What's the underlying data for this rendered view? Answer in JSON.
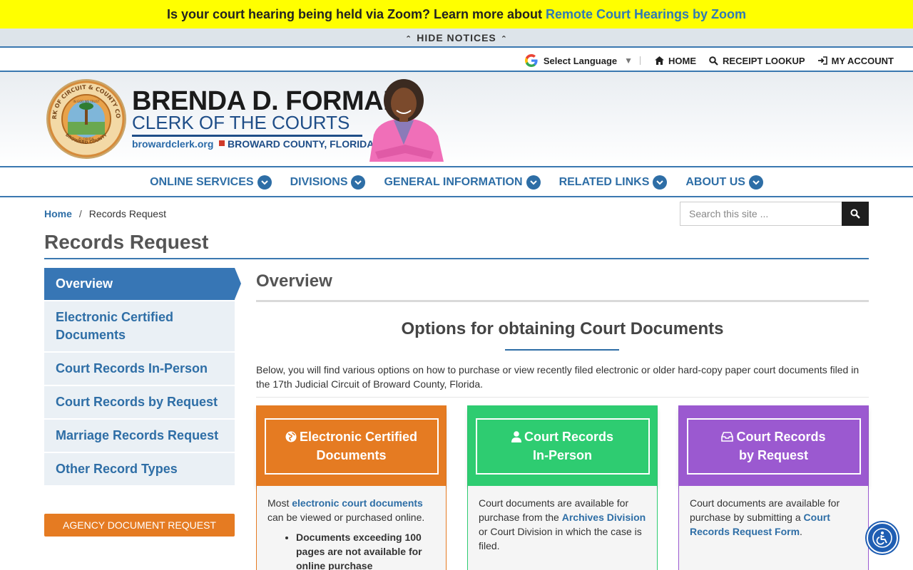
{
  "notice": {
    "text": "Is your court hearing being held via Zoom? Learn more about ",
    "link": "Remote Court Hearings by Zoom",
    "hide_label": "HIDE NOTICES"
  },
  "utility": {
    "language": "Select Language",
    "home": "HOME",
    "receipt": "RECEIPT LOOKUP",
    "account": "MY ACCOUNT"
  },
  "header": {
    "name": "BRENDA D. FORMAN",
    "title": "CLERK OF THE COURTS",
    "site": "browardclerk.org",
    "county": "BROWARD COUNTY, FLORIDA",
    "seal_text": "CLERK OF CIRCUIT & COUNTY COURT",
    "seal_bottom": "BROWARD COUNTY",
    "seal_motto": "IN GOD WE TRUST",
    "seal_state": "FLORIDA"
  },
  "nav": [
    {
      "label": "ONLINE SERVICES"
    },
    {
      "label": "DIVISIONS"
    },
    {
      "label": "GENERAL INFORMATION"
    },
    {
      "label": "RELATED LINKS"
    },
    {
      "label": "ABOUT US"
    }
  ],
  "breadcrumb": {
    "home": "Home",
    "sep": "/",
    "current": "Records Request"
  },
  "search": {
    "placeholder": "Search this site ..."
  },
  "page_title": "Records Request",
  "sidenav": [
    {
      "label": "Overview"
    },
    {
      "label": "Electronic Certified Documents"
    },
    {
      "label": "Court Records In-Person"
    },
    {
      "label": "Court Records by Request"
    },
    {
      "label": "Marriage Records Request"
    },
    {
      "label": "Other Record Types"
    }
  ],
  "agency_button": "AGENCY DOCUMENT REQUEST",
  "content": {
    "heading": "Overview",
    "options_heading": "Options for obtaining Court Documents",
    "intro": "Below, you will find various options on how to purchase or view recently filed electronic or older hard-copy paper court documents filed in the 17th Judicial Circuit of Broward County, Florida."
  },
  "cards": [
    {
      "title_line1": "Electronic Certified",
      "title_line2": "Documents",
      "text_before": "Most ",
      "link": "electronic court documents",
      "text_after": " can be viewed or purchased online.",
      "bullet": "Documents exceeding 100 pages are not available for online purchase"
    },
    {
      "title_line1": "Court Records",
      "title_line2": "In-Person",
      "text_before": "Court documents are available for purchase from the ",
      "link": "Archives Division",
      "text_after": " or Court Division in which the case is filed."
    },
    {
      "title_line1": "Court Records",
      "title_line2": "by Request",
      "text_before": "Court documents are available for purchase by submitting a ",
      "link": "Court Records Request Form",
      "text_after": "."
    }
  ],
  "colors": {
    "notice_bg": "#ffff00",
    "brand_blue": "#2e6ea6",
    "orange": "#e57b22",
    "green": "#2ecc71",
    "purple": "#9b59d0"
  }
}
